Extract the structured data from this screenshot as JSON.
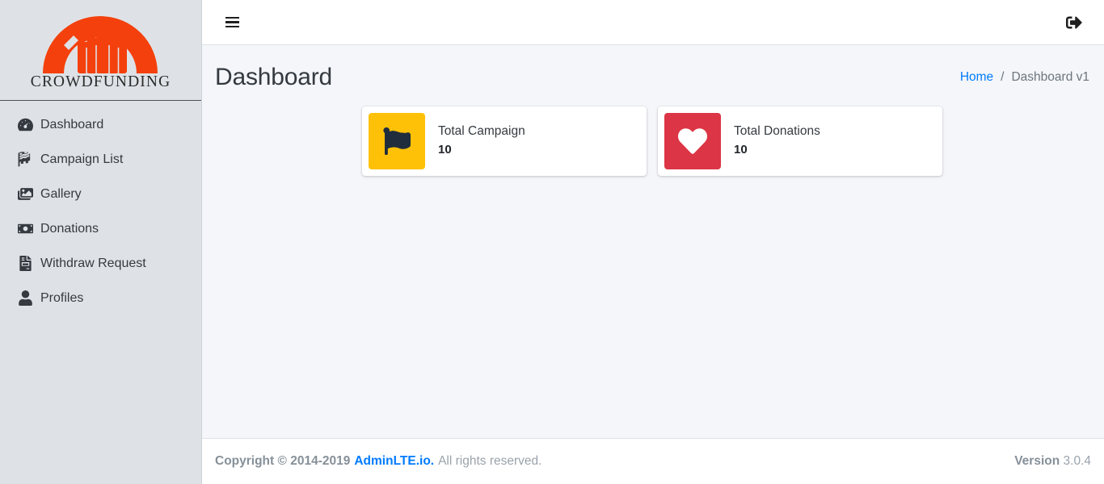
{
  "brand": {
    "logo_icon": "crowdfunding-arch-people-logo",
    "wordmark": "CROWDFUNDING",
    "logo_color": "#f4400c"
  },
  "sidebar": {
    "items": [
      {
        "label": "Dashboard",
        "icon": "tachometer-icon"
      },
      {
        "label": "Campaign List",
        "icon": "checkered-flag-icon"
      },
      {
        "label": "Gallery",
        "icon": "images-icon"
      },
      {
        "label": "Donations",
        "icon": "money-bill-icon"
      },
      {
        "label": "Withdraw Request",
        "icon": "file-invoice-icon"
      },
      {
        "label": "Profiles",
        "icon": "user-icon"
      }
    ]
  },
  "topbar": {
    "menu_toggle_icon": "hamburger-icon",
    "signout_icon": "sign-out-icon"
  },
  "content_header": {
    "title": "Dashboard",
    "breadcrumb": {
      "home": "Home",
      "separator": "/",
      "current": "Dashboard v1"
    }
  },
  "cards": [
    {
      "text": "Total Campaign",
      "number": "10",
      "icon": "flag-icon",
      "icon_bg": "#ffc107",
      "icon_color": "#1f2d3d"
    },
    {
      "text": "Total Donations",
      "number": "10",
      "icon": "heart-icon",
      "icon_bg": "#dc3545",
      "icon_color": "#ffffff"
    }
  ],
  "footer": {
    "copyright": "Copyright © 2014-2019",
    "link": "AdminLTE.io.",
    "rights": "All rights reserved.",
    "version_label": "Version",
    "version_number": "3.0.4"
  }
}
